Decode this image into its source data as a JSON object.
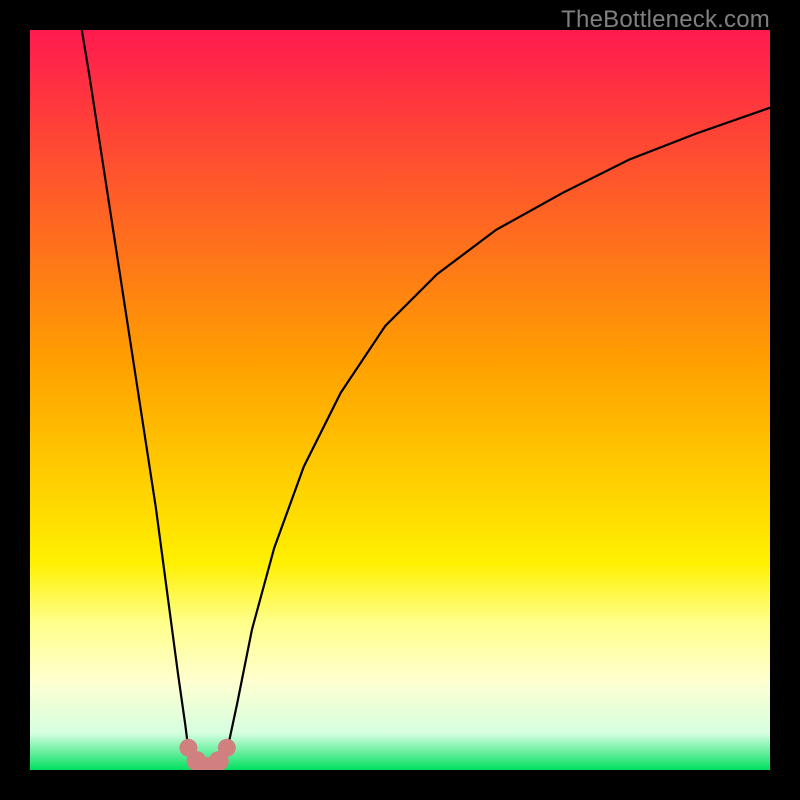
{
  "watermark": "TheBottleneck.com",
  "chart_data": {
    "type": "line",
    "title": "",
    "xlabel": "",
    "ylabel": "",
    "xlim": [
      0,
      1
    ],
    "ylim": [
      0,
      1
    ],
    "gradient_stops": [
      {
        "pos": 0.0,
        "color": "#ff1a4f"
      },
      {
        "pos": 0.45,
        "color": "#ffa000"
      },
      {
        "pos": 0.72,
        "color": "#fff000"
      },
      {
        "pos": 0.8,
        "color": "#ffff8a"
      },
      {
        "pos": 0.88,
        "color": "#ffffd0"
      },
      {
        "pos": 0.95,
        "color": "#d6ffe0"
      },
      {
        "pos": 1.0,
        "color": "#00e060"
      }
    ],
    "series": [
      {
        "name": "left-branch",
        "x": [
          0.07,
          0.08,
          0.09,
          0.1,
          0.11,
          0.12,
          0.13,
          0.14,
          0.15,
          0.16,
          0.17,
          0.18,
          0.19,
          0.2,
          0.21,
          0.215
        ],
        "y": [
          1.0,
          0.94,
          0.875,
          0.81,
          0.745,
          0.68,
          0.615,
          0.55,
          0.485,
          0.42,
          0.355,
          0.28,
          0.205,
          0.13,
          0.06,
          0.02
        ]
      },
      {
        "name": "valley",
        "x": [
          0.215,
          0.225,
          0.235,
          0.245,
          0.255,
          0.265
        ],
        "y": [
          0.02,
          0.008,
          0.003,
          0.003,
          0.008,
          0.02
        ]
      },
      {
        "name": "right-branch",
        "x": [
          0.265,
          0.28,
          0.3,
          0.33,
          0.37,
          0.42,
          0.48,
          0.55,
          0.63,
          0.72,
          0.81,
          0.9,
          1.0
        ],
        "y": [
          0.02,
          0.09,
          0.19,
          0.3,
          0.41,
          0.51,
          0.6,
          0.67,
          0.73,
          0.78,
          0.825,
          0.86,
          0.895
        ]
      }
    ],
    "valley_markers": {
      "color": "#d18080",
      "points": [
        {
          "x": 0.214,
          "y": 0.03,
          "r": 9
        },
        {
          "x": 0.225,
          "y": 0.012,
          "r": 10
        },
        {
          "x": 0.24,
          "y": 0.004,
          "r": 10
        },
        {
          "x": 0.255,
          "y": 0.012,
          "r": 10
        },
        {
          "x": 0.266,
          "y": 0.03,
          "r": 9
        }
      ]
    }
  }
}
